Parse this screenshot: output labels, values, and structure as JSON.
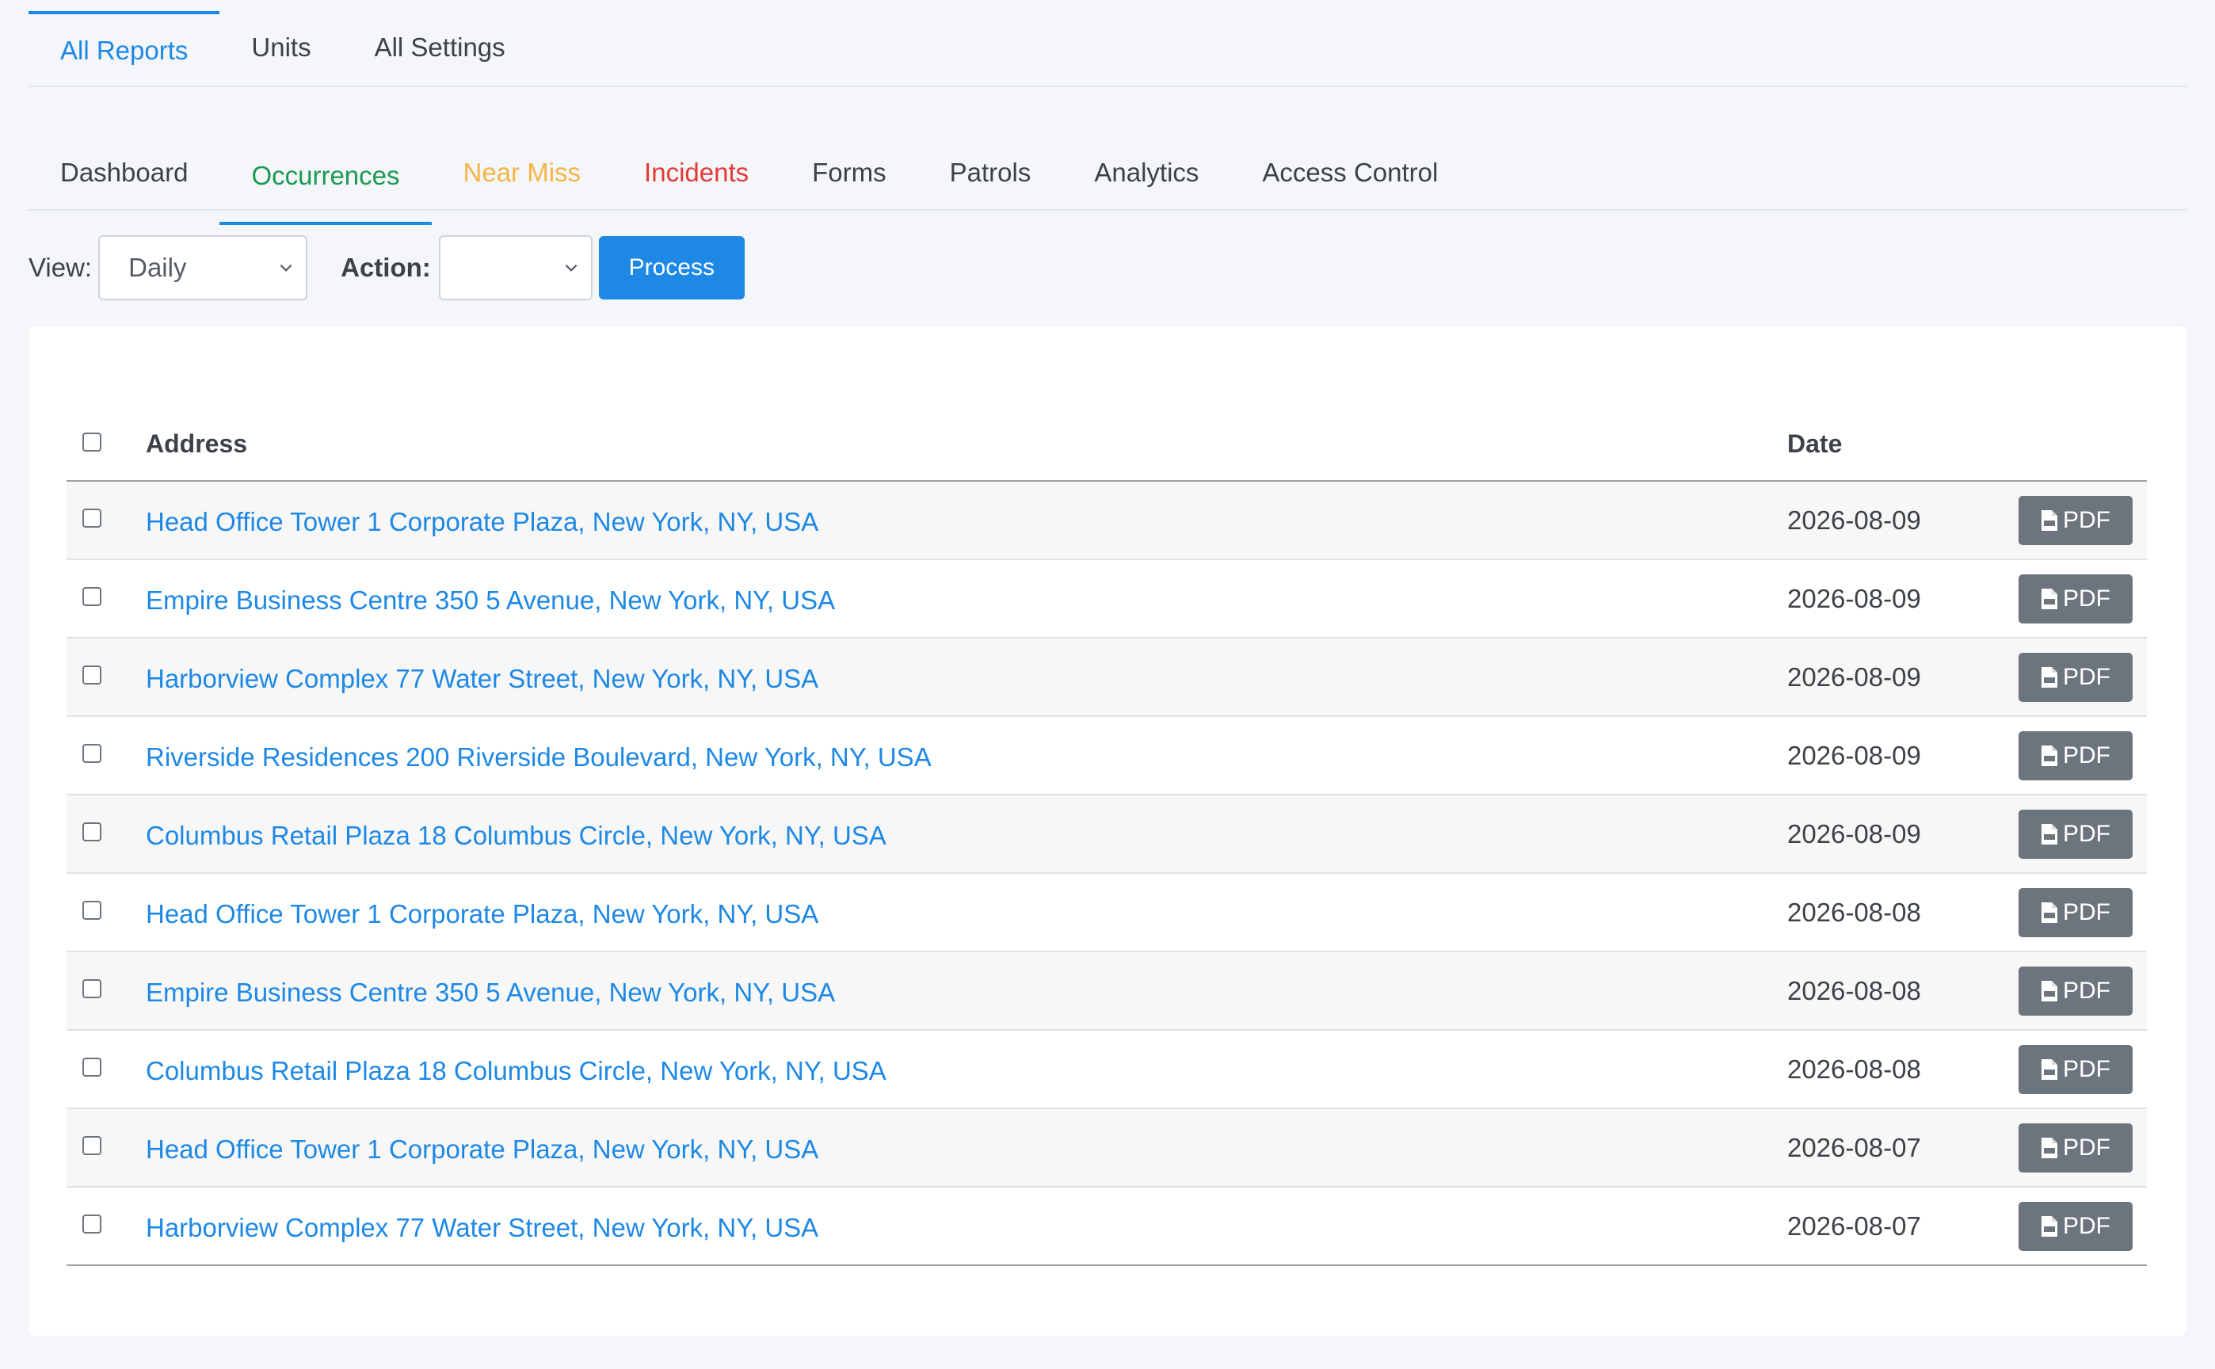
{
  "top_tabs": [
    {
      "label": "All Reports",
      "active": true
    },
    {
      "label": "Units",
      "active": false
    },
    {
      "label": "All Settings",
      "active": false
    }
  ],
  "sub_tabs": [
    {
      "label": "Dashboard"
    },
    {
      "label": "Occurrences",
      "active": true,
      "color": "#1a9a52"
    },
    {
      "label": "Near Miss",
      "color": "#f6b545"
    },
    {
      "label": "Incidents",
      "color": "#e53935"
    },
    {
      "label": "Forms"
    },
    {
      "label": "Patrols"
    },
    {
      "label": "Analytics"
    },
    {
      "label": "Access Control"
    }
  ],
  "controls": {
    "view_label": "View:",
    "view_value": "Daily",
    "action_label": "Action:",
    "action_value": "",
    "process_label": "Process"
  },
  "table": {
    "headers": {
      "address": "Address",
      "date": "Date"
    },
    "pdf_label": "PDF",
    "rows": [
      {
        "address": "Head Office Tower 1 Corporate Plaza, New York, NY, USA",
        "date": "2026-08-09"
      },
      {
        "address": "Empire Business Centre 350 5 Avenue, New York, NY, USA",
        "date": "2026-08-09"
      },
      {
        "address": "Harborview Complex 77 Water Street, New York, NY, USA",
        "date": "2026-08-09"
      },
      {
        "address": "Riverside Residences 200 Riverside Boulevard, New York, NY, USA",
        "date": "2026-08-09"
      },
      {
        "address": "Columbus Retail Plaza 18 Columbus Circle, New York, NY, USA",
        "date": "2026-08-09"
      },
      {
        "address": "Head Office Tower 1 Corporate Plaza, New York, NY, USA",
        "date": "2026-08-08"
      },
      {
        "address": "Empire Business Centre 350 5 Avenue, New York, NY, USA",
        "date": "2026-08-08"
      },
      {
        "address": "Columbus Retail Plaza 18 Columbus Circle, New York, NY, USA",
        "date": "2026-08-08"
      },
      {
        "address": "Head Office Tower 1 Corporate Plaza, New York, NY, USA",
        "date": "2026-08-07"
      },
      {
        "address": "Harborview Complex 77 Water Street, New York, NY, USA",
        "date": "2026-08-07"
      }
    ]
  },
  "colors": {
    "accent": "#1e88e5",
    "pdf_button": "#6c757d"
  },
  "icons": {
    "select_chevron": "chevron-down-icon",
    "pdf": "file-pdf-icon"
  }
}
